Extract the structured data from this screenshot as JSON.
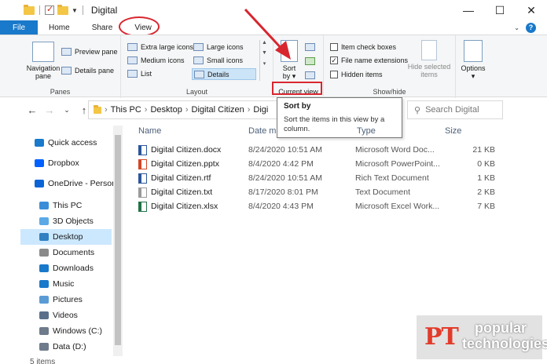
{
  "window": {
    "title": "Digital"
  },
  "tabs": {
    "file": "File",
    "home": "Home",
    "share": "Share",
    "view": "View"
  },
  "ribbon": {
    "panes": {
      "label": "Panes",
      "navigation_pane": "Navigation pane",
      "preview_pane": "Preview pane",
      "details_pane": "Details pane"
    },
    "layout": {
      "label": "Layout",
      "extra_large": "Extra large icons",
      "large": "Large icons",
      "medium": "Medium icons",
      "small": "Small icons",
      "list": "List",
      "details": "Details"
    },
    "current_view": {
      "label": "Current view",
      "sort_by": "Sort by"
    },
    "show_hide": {
      "label": "Show/hide",
      "item_checkboxes": "Item check boxes",
      "file_name_extensions": "File name extensions",
      "hidden_items": "Hidden items",
      "hide_selected": "Hide selected items",
      "options": "Options"
    }
  },
  "address": {
    "crumbs": [
      "This PC",
      "Desktop",
      "Digital Citizen",
      "Digi"
    ],
    "search_placeholder": "Search Digital"
  },
  "tooltip": {
    "title": "Sort by",
    "body": "Sort the items in this view by a column."
  },
  "columns": {
    "name": "Name",
    "date": "Date m",
    "type": "Type",
    "size": "Size"
  },
  "files": [
    {
      "name": "Digital Citizen.docx",
      "date": "8/24/2020 10:51 AM",
      "type": "Microsoft Word Doc...",
      "size": "21 KB",
      "icon_color": "#2b579a"
    },
    {
      "name": "Digital Citizen.pptx",
      "date": "8/4/2020 4:42 PM",
      "type": "Microsoft PowerPoint...",
      "size": "0 KB",
      "icon_color": "#d24726"
    },
    {
      "name": "Digital Citizen.rtf",
      "date": "8/24/2020 10:51 AM",
      "type": "Rich Text Document",
      "size": "1 KB",
      "icon_color": "#2b579a"
    },
    {
      "name": "Digital Citizen.txt",
      "date": "8/17/2020 8:01 PM",
      "type": "Text Document",
      "size": "2 KB",
      "icon_color": "#9a9a9a"
    },
    {
      "name": "Digital Citizen.xlsx",
      "date": "8/4/2020 4:43 PM",
      "type": "Microsoft Excel Work...",
      "size": "7 KB",
      "icon_color": "#217346"
    }
  ],
  "nav": {
    "items": [
      {
        "label": "Quick access",
        "icon": "star-icon",
        "color": "#1979ca"
      },
      {
        "label": "Dropbox",
        "icon": "dropbox-icon",
        "color": "#0061fe"
      },
      {
        "label": "OneDrive - Person",
        "icon": "cloud-icon",
        "color": "#0a64d6"
      },
      {
        "label": "This PC",
        "icon": "computer-icon",
        "color": "#3c8dd8"
      },
      {
        "label": "3D Objects",
        "icon": "cube-icon",
        "color": "#5aa9e6"
      },
      {
        "label": "Desktop",
        "icon": "desktop-icon",
        "color": "#2f7fc1"
      },
      {
        "label": "Documents",
        "icon": "documents-icon",
        "color": "#8a8a8a"
      },
      {
        "label": "Downloads",
        "icon": "download-icon",
        "color": "#1979ca"
      },
      {
        "label": "Music",
        "icon": "music-icon",
        "color": "#1979ca"
      },
      {
        "label": "Pictures",
        "icon": "pictures-icon",
        "color": "#5a9bd5"
      },
      {
        "label": "Videos",
        "icon": "videos-icon",
        "color": "#5a6f8a"
      },
      {
        "label": "Windows (C:)",
        "icon": "drive-icon",
        "color": "#6e7b8b"
      },
      {
        "label": "Data (D:)",
        "icon": "drive-icon",
        "color": "#6e7b8b"
      }
    ]
  },
  "status": {
    "items": "5 items"
  },
  "watermark": {
    "pt": "PT",
    "line1": "popular",
    "line2": "technologies"
  },
  "colors": {
    "accent": "#1979ca",
    "annotation": "#d8262f",
    "selection": "#cce8ff"
  }
}
